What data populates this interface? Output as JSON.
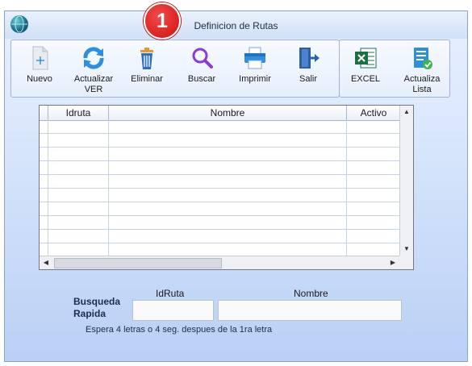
{
  "window": {
    "title": "Definicion de Rutas"
  },
  "toolbar": {
    "nuevo": "Nuevo",
    "actualizar_ver_1": "Actualizar",
    "actualizar_ver_2": "VER",
    "eliminar": "Eliminar",
    "buscar": "Buscar",
    "imprimir": "Imprimir",
    "salir": "Salir",
    "excel": "EXCEL",
    "actualiza_lista_1": "Actualiza",
    "actualiza_lista_2": "Lista"
  },
  "annotation": {
    "badge": "1"
  },
  "table": {
    "columns": [
      "Idruta",
      "Nombre",
      "Activo"
    ],
    "rows": []
  },
  "search": {
    "title_1": "Busqueda",
    "title_2": "Rapida",
    "idruta_label": "IdRuta",
    "nombre_label": "Nombre",
    "idruta_value": "",
    "nombre_value": "",
    "hint": "Espera 4 letras o 4 seg. despues de la 1ra letra"
  },
  "colors": {
    "accent": "#2e7be6",
    "badge": "#d91a1a",
    "excel": "#1e7145",
    "search_icon": "#8a3bd1"
  }
}
